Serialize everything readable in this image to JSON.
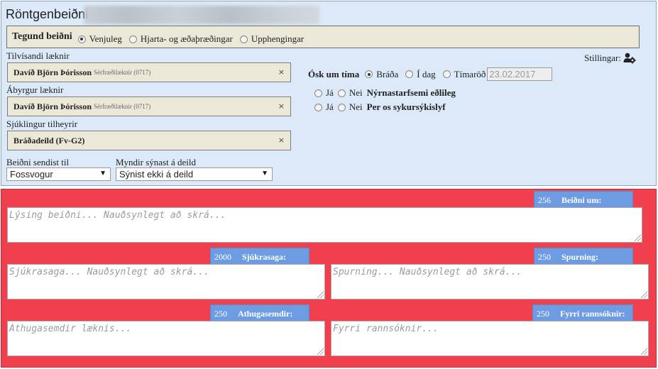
{
  "header": {
    "title": "Röntgenbeiðni"
  },
  "request_type": {
    "label": "Tegund beiðni",
    "options": [
      {
        "label": "Venjuleg",
        "selected": true
      },
      {
        "label": "Hjarta- og æðaþræðingar",
        "selected": false
      },
      {
        "label": "Upphengingar",
        "selected": false
      }
    ]
  },
  "referring_doctor": {
    "label": "Tilvísandi læknir",
    "name": "Davíð Björn Þórisson",
    "detail": "Sérfræðilæknir (0717)",
    "remove": "×"
  },
  "responsible_doctor": {
    "label": "Ábyrgur læknir",
    "name": "Davíð Björn Þórisson",
    "detail": "Sérfræðilæknir (0717)",
    "remove": "×"
  },
  "patient_unit": {
    "label": "Sjúklingur tilheyrir",
    "name": "Bráðadeild (Fv-G2)",
    "remove": "×"
  },
  "sent_to": {
    "label": "Beiðni sendist til",
    "value": "Fossvogur"
  },
  "images_shown": {
    "label": "Myndir sýnast á deild",
    "value": "Sýnist ekki á deild"
  },
  "settings": {
    "label": "Stillingar:",
    "icon": "user-gear-icon"
  },
  "timing": {
    "label": "Ósk um tíma",
    "options": [
      {
        "label": "Bráða",
        "selected": true
      },
      {
        "label": "Í dag",
        "selected": false
      },
      {
        "label": "Tímaröð",
        "selected": false
      }
    ],
    "date_placeholder": "23.02.2017"
  },
  "questions": [
    {
      "yes": "Já",
      "no": "Nei",
      "text": "Nýrnastarfsemi eðlileg"
    },
    {
      "yes": "Já",
      "no": "Nei",
      "text": "Per os sykursýkislyf"
    }
  ],
  "fields": {
    "request_about": {
      "count": "256",
      "label": "Beiðni um:",
      "placeholder": "Lýsing beiðni... Nauðsynlegt að skrá..."
    },
    "history": {
      "count": "2000",
      "label": "Sjúkrasaga:",
      "placeholder": "Sjúkrasaga... Nauðsynlegt að skrá..."
    },
    "question": {
      "count": "250",
      "label": "Spurning:",
      "placeholder": "Spurning... Nauðsynlegt að skrá..."
    },
    "notes": {
      "count": "250",
      "label": "Athugasemdir:",
      "placeholder": "Athugasemdir læknis..."
    },
    "prior": {
      "count": "250",
      "label": "Fyrri rannsóknir:",
      "placeholder": "Fyrri rannsóknir..."
    }
  },
  "colors": {
    "top_panel": "#dbe9f9",
    "bottom_panel": "#f0404e",
    "badge": "#6d9ce2",
    "tag_bg": "#ebe8d8"
  }
}
